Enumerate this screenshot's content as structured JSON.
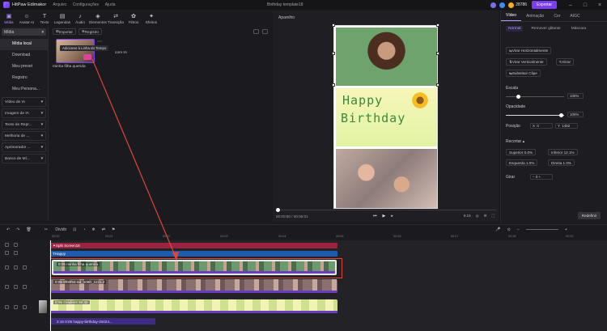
{
  "app": {
    "name": "HitPaw Edimakor",
    "menu": [
      "Arquivo",
      "Configurações",
      "Ajuda"
    ],
    "doc_title": "Birthday template18",
    "coins": "28786",
    "export": "Exportar"
  },
  "toolbar": [
    {
      "label": "Mídia",
      "icon": "media-icon"
    },
    {
      "label": "Avatar AI",
      "icon": "avatar-icon"
    },
    {
      "label": "Texto",
      "icon": "text-icon"
    },
    {
      "label": "Legendas",
      "icon": "captions-icon"
    },
    {
      "label": "Áudio",
      "icon": "audio-icon"
    },
    {
      "label": "Elementos",
      "icon": "elements-icon"
    },
    {
      "label": "Transição",
      "icon": "transition-icon"
    },
    {
      "label": "Filtros",
      "icon": "filters-icon"
    },
    {
      "label": "Efeitos",
      "icon": "effects-icon"
    }
  ],
  "leftnav": {
    "head": "Mídia",
    "items": [
      "Mídia local",
      "Download",
      "Meu preset",
      "Registro",
      "Meu Persona..."
    ],
    "groups": [
      "Vídeo de IA",
      "Imagem de IA",
      "Texto de Repr...",
      "Melhoria de ...",
      "Aprimorador ...",
      "Banco de Mí..."
    ]
  },
  "media": {
    "import": "Importar",
    "record": "Registro",
    "thumb_label": "minha filha querida",
    "tooltip": "Adicionar à Linha do Tempo",
    "tooltip_tail": "com IA"
  },
  "player": {
    "title": "Aparelho",
    "card_line1": "Happy",
    "card_line2": "Birthday",
    "time_current": "00:00:00",
    "time_total": "00:05:01",
    "ratio": "9:16"
  },
  "props": {
    "tabs": [
      "Vídeo",
      "Animação",
      "Cor",
      "AIGC"
    ],
    "subtabs": [
      "Normal",
      "Remover glitante",
      "Máscara"
    ],
    "btn_flip_h": "Virar Horizontalmente",
    "btn_flip_v": "Virar Verticalmente",
    "btn_rotate": "Girar",
    "btn_replace": "Substituir Clipe",
    "scale_label": "Escala",
    "scale_val": "100%",
    "opacity_label": "Opacidade",
    "opacity_val": "100%",
    "position_label": "Posição",
    "pos_x": "X",
    "pos_x_val": "0",
    "pos_y": "Y",
    "pos_y_val": "1482",
    "crop_label": "Recortar",
    "crop_top": "Superior 0.0%",
    "crop_bottom": "Inferior 12.1%",
    "crop_left": "Esquerda 1.0%",
    "crop_right": "Direita 1.0%",
    "rotate_label": "Girar",
    "rotate_val": "0",
    "reset": "Redefinir"
  },
  "timeline": {
    "split": "Dividir",
    "ruler": [
      "00:00",
      "00:01",
      "00:02",
      "00:03",
      "00:04",
      "00:05",
      "00:06",
      "00:07",
      "00:08",
      "00:09"
    ],
    "clips": [
      "Split Screen18",
      "Happy"
    ],
    "video1": "0:05 minha filha querida",
    "video2": "0:05 8f00f94-6d_1080_1131.2",
    "video3": "0:05 Gradient 80:42",
    "audio": "2:16 0:05 happy-birthday-2s024..."
  }
}
